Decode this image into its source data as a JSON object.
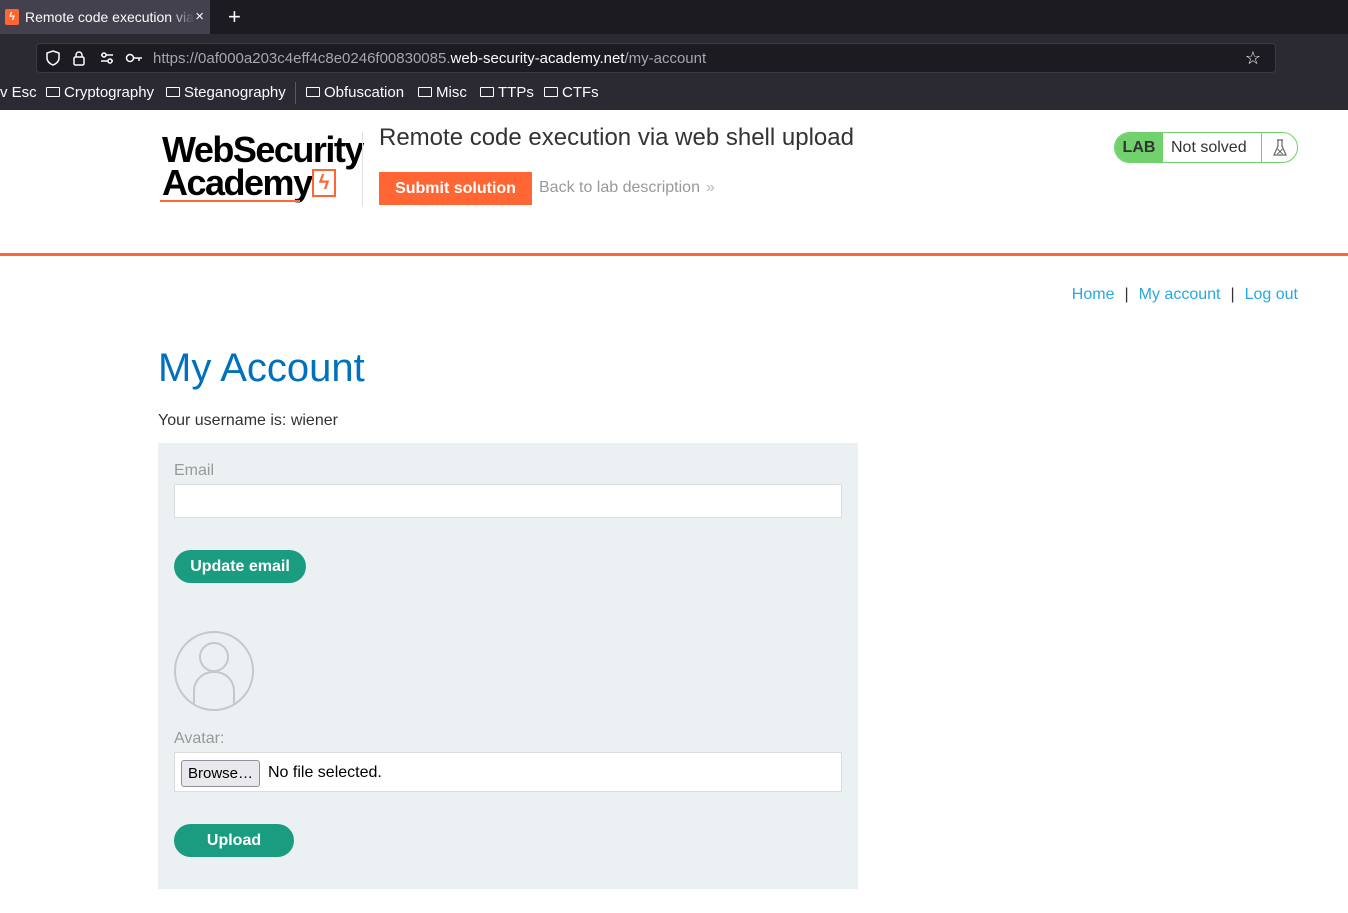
{
  "browser": {
    "tab_title": "Remote code execution via web shell upload",
    "tab_close": "×",
    "new_tab": "+",
    "url_prefix": "https://0af000a203c4eff4c8e0246f00830085.",
    "url_host": "web-security-academy.net",
    "url_path": "/my-account",
    "bookmarks": [
      {
        "label": "v Esc",
        "folder": false
      },
      {
        "label": "Cryptography",
        "folder": true
      },
      {
        "label": "Steganography",
        "folder": true
      },
      {
        "label": "Obfuscation",
        "folder": true
      },
      {
        "label": "Misc",
        "folder": true
      },
      {
        "label": "TTPs",
        "folder": true
      },
      {
        "label": "CTFs",
        "folder": true
      }
    ]
  },
  "header": {
    "logo_line1": "WebSecurity",
    "logo_line2": "Academy",
    "lab_title": "Remote code execution via web shell upload",
    "submit_label": "Submit solution",
    "back_label": "Back to lab description",
    "back_chevron": "»",
    "badge_tag": "LAB",
    "badge_status": "Not solved",
    "accent_color": "#ff6633",
    "badge_color": "#70d16d"
  },
  "nav": {
    "home": "Home",
    "my_account": "My account",
    "log_out": "Log out",
    "separator": "|"
  },
  "main": {
    "title": "My Account",
    "username_line": "Your username is: wiener",
    "email_label": "Email",
    "email_value": "",
    "update_email_label": "Update email",
    "avatar_label": "Avatar:",
    "browse_label": "Browse…",
    "file_status": "No file selected.",
    "upload_label": "Upload",
    "button_color": "#1a9c80",
    "title_color": "#0071bc"
  }
}
